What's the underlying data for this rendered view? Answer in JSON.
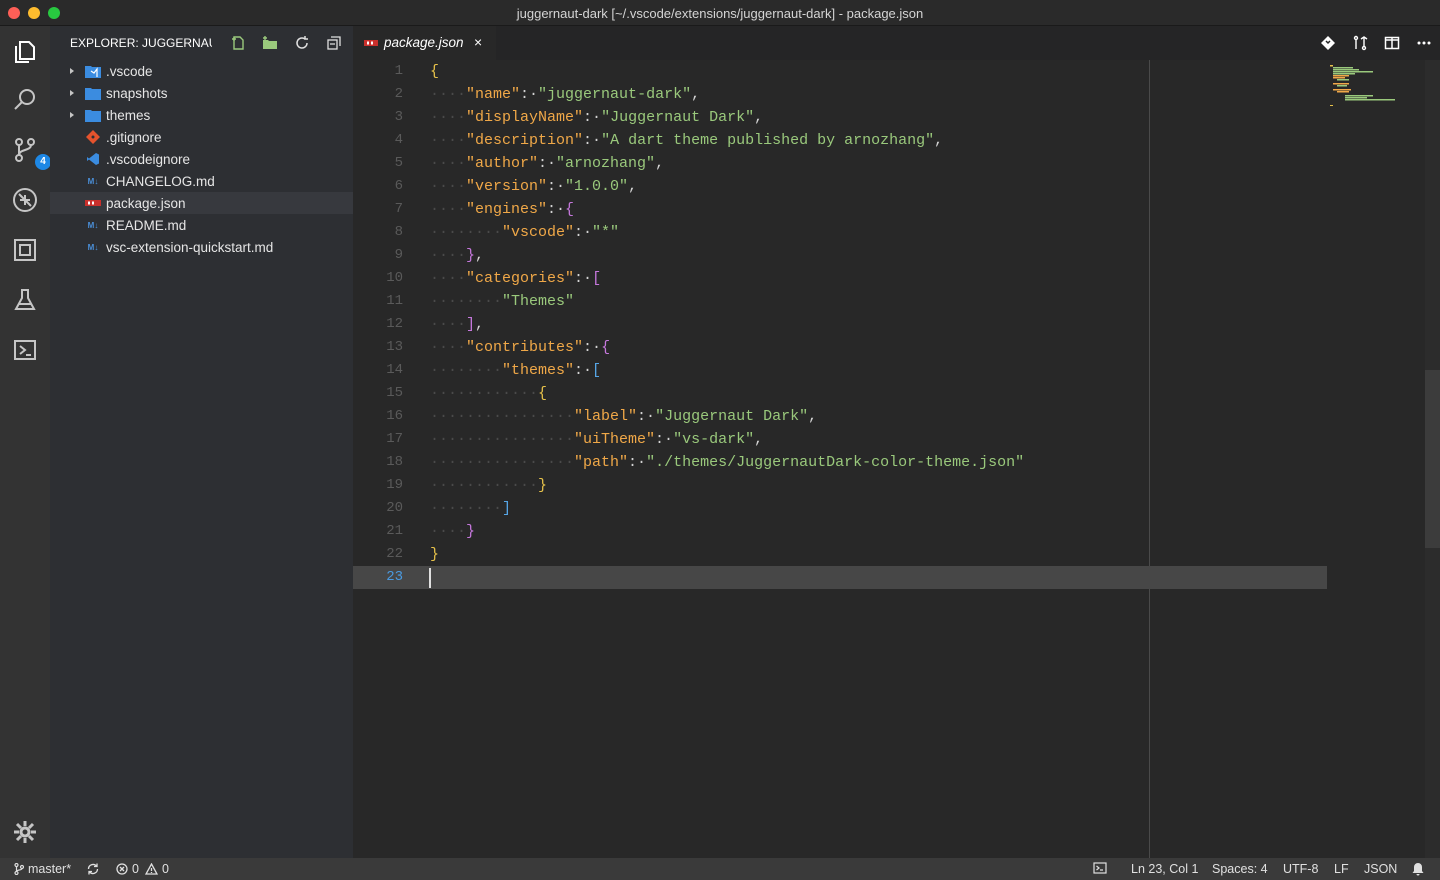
{
  "window": {
    "title": "juggernaut-dark [~/.vscode/extensions/juggernaut-dark] - package.json"
  },
  "activity_bar": {
    "items": [
      {
        "name": "explorer-icon"
      },
      {
        "name": "search-icon"
      },
      {
        "name": "source-control-icon",
        "badge": "4"
      },
      {
        "name": "debug-icon"
      },
      {
        "name": "extensions-icon"
      },
      {
        "name": "test-flask-icon"
      },
      {
        "name": "terminal-icon"
      }
    ],
    "settings_icon": "gear-icon"
  },
  "sidebar": {
    "title": "EXPLORER: JUGGERNAU...",
    "actions": [
      "new-file-icon",
      "new-folder-icon",
      "refresh-icon",
      "collapse-all-icon"
    ],
    "items": [
      {
        "label": ".vscode",
        "type": "folder",
        "icon": "vscode-folder-icon"
      },
      {
        "label": "snapshots",
        "type": "folder",
        "icon": "folder-icon"
      },
      {
        "label": "themes",
        "type": "folder",
        "icon": "folder-icon"
      },
      {
        "label": ".gitignore",
        "type": "file",
        "icon": "git-icon"
      },
      {
        "label": ".vscodeignore",
        "type": "file",
        "icon": "vscode-icon"
      },
      {
        "label": "CHANGELOG.md",
        "type": "file",
        "icon": "markdown-icon"
      },
      {
        "label": "package.json",
        "type": "file",
        "icon": "npm-icon",
        "selected": true
      },
      {
        "label": "README.md",
        "type": "file",
        "icon": "markdown-icon"
      },
      {
        "label": "vsc-extension-quickstart.md",
        "type": "file",
        "icon": "markdown-icon"
      }
    ]
  },
  "editor": {
    "tab": {
      "label": "package.json",
      "close": "×"
    },
    "actions": [
      "git-compare-icon",
      "open-changes-icon",
      "split-editor-icon",
      "more-actions-icon"
    ],
    "lines": [
      {
        "n": "1"
      },
      {
        "n": "2"
      },
      {
        "n": "3"
      },
      {
        "n": "4"
      },
      {
        "n": "5"
      },
      {
        "n": "6"
      },
      {
        "n": "7"
      },
      {
        "n": "8"
      },
      {
        "n": "9"
      },
      {
        "n": "10"
      },
      {
        "n": "11"
      },
      {
        "n": "12"
      },
      {
        "n": "13"
      },
      {
        "n": "14"
      },
      {
        "n": "15"
      },
      {
        "n": "16"
      },
      {
        "n": "17"
      },
      {
        "n": "18"
      },
      {
        "n": "19"
      },
      {
        "n": "20"
      },
      {
        "n": "21"
      },
      {
        "n": "22"
      },
      {
        "n": "23"
      }
    ],
    "code": {
      "name_key": "\"name\"",
      "name_val": "\"juggernaut-dark\"",
      "display_key": "\"displayName\"",
      "display_val": "\"Juggernaut Dark\"",
      "desc_key": "\"description\"",
      "desc_val": "\"A dart theme published by arnozhang\"",
      "author_key": "\"author\"",
      "author_val": "\"arnozhang\"",
      "version_key": "\"version\"",
      "version_val": "\"1.0.0\"",
      "engines_key": "\"engines\"",
      "vscode_key": "\"vscode\"",
      "vscode_val": "\"*\"",
      "categories_key": "\"categories\"",
      "themes_cat_val": "\"Themes\"",
      "contributes_key": "\"contributes\"",
      "themes_key": "\"themes\"",
      "label_key": "\"label\"",
      "label_val": "\"Juggernaut Dark\"",
      "uitheme_key": "\"uiTheme\"",
      "uitheme_val": "\"vs-dark\"",
      "path_key": "\"path\"",
      "path_val": "\"./themes/JuggernautDark-color-theme.json\""
    }
  },
  "status_bar": {
    "branch": "master*",
    "errors": "0",
    "warnings": "0",
    "position": "Ln 23, Col 1",
    "spaces": "Spaces: 4",
    "encoding": "UTF-8",
    "eol": "LF",
    "language": "JSON"
  },
  "colors": {
    "key": "#f0a848",
    "string": "#9ac97c",
    "accent": "#1e88e5"
  }
}
